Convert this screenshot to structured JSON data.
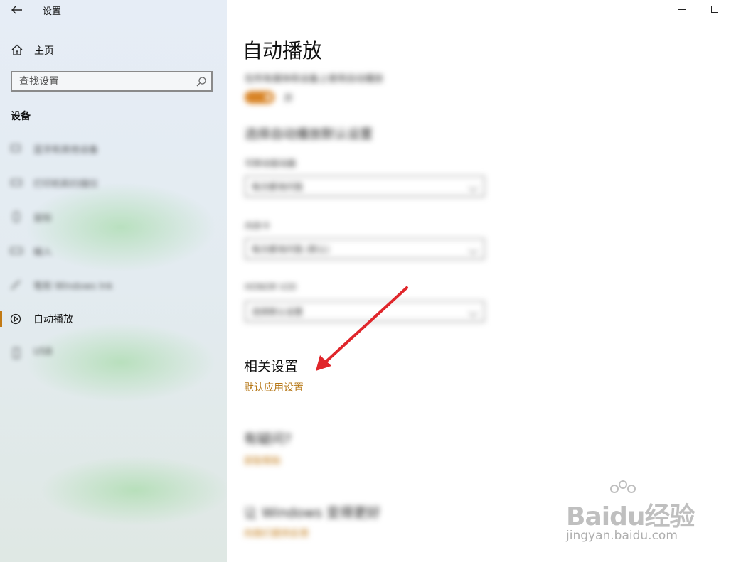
{
  "window": {
    "title": "设置",
    "minimize_glyph": "—",
    "maximize_glyph": "☐"
  },
  "sidebar": {
    "home_label": "主页",
    "search_placeholder": "查找设置",
    "section_title": "设备",
    "items": [
      {
        "label": "蓝牙和其他设备",
        "icon": "bluetooth-icon",
        "blurred": true
      },
      {
        "label": "打印机和扫描仪",
        "icon": "printer-icon",
        "blurred": true
      },
      {
        "label": "鼠标",
        "icon": "mouse-icon",
        "blurred": true
      },
      {
        "label": "输入",
        "icon": "keyboard-icon",
        "blurred": true
      },
      {
        "label": "笔和 Windows Ink",
        "icon": "pen-icon",
        "blurred": true
      },
      {
        "label": "自动播放",
        "icon": "autoplay-icon",
        "blurred": false,
        "active": true
      },
      {
        "label": "USB",
        "icon": "usb-icon",
        "blurred": true
      }
    ]
  },
  "main": {
    "page_title": "自动播放",
    "autoplay_toggle_label": "在所有媒体和设备上使用自动播放",
    "autoplay_toggle_state": "开",
    "defaults_heading": "选择自动播放默认设置",
    "dropdowns": [
      {
        "label": "可移动驱动器",
        "value": "每次都询问我"
      },
      {
        "label": "内存卡",
        "value": "每次都询问我 (默认)"
      },
      {
        "label": "HONOR V20",
        "value": "选择默认设置"
      }
    ],
    "related_heading": "相关设置",
    "related_link": "默认应用设置",
    "help_heading": "有疑问?",
    "help_link": "获取帮助",
    "feedback_heading": "让 Windows 变得更好",
    "feedback_link": "向我们提供反馈"
  },
  "colors": {
    "accent": "#c27a14",
    "link": "#b77818",
    "annotation_arrow": "#e0262b"
  },
  "watermark": {
    "brand": "Baidu经验",
    "url": "jingyan.baidu.com"
  }
}
